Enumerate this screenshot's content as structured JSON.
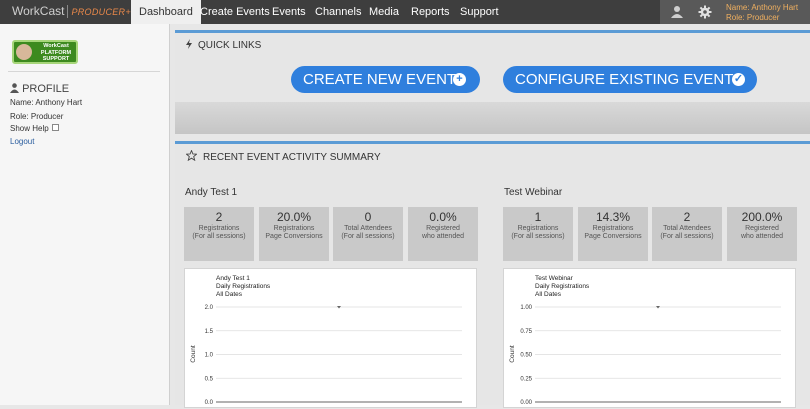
{
  "app": {
    "brand": "WorkCast",
    "product": "PRODUCER+"
  },
  "nav": [
    "Dashboard",
    "Create Events",
    "Events",
    "Channels",
    "Media",
    "Reports",
    "Support"
  ],
  "user": {
    "name_line": "Name: Anthony Hart",
    "role_line": "Role: Producer"
  },
  "sidebar": {
    "badge_lines": [
      "WorkCast",
      "PLATFORM",
      "SUPPORT"
    ],
    "profile_heading": "PROFILE",
    "name": "Name: Anthony Hart",
    "role": "Role: Producer",
    "show_help": "Show Help",
    "logout": "Logout"
  },
  "quick_links": {
    "heading": "QUICK LINKS",
    "create_label": "CREATE NEW EVENT",
    "configure_label": "CONFIGURE EXISTING EVENT"
  },
  "recent": {
    "heading": "RECENT EVENT ACTIVITY SUMMARY",
    "events": [
      {
        "title": "Andy Test 1",
        "stats": [
          {
            "value": "2",
            "label": "Registrations\n(For all sessions)"
          },
          {
            "value": "20.0%",
            "label": "Registrations\nPage Conversions"
          },
          {
            "value": "0",
            "label": "Total Attendees\n(For all sessions)"
          },
          {
            "value": "0.0%",
            "label": "Registered\nwho attended"
          }
        ],
        "chart_data": {
          "type": "line",
          "title": "Andy Test 1\nDaily Registrations\nAll Dates",
          "ylabel": "Count",
          "yticks": [
            "2.0",
            "1.5",
            "1.0",
            "0.5",
            "0.0"
          ],
          "ylim": [
            0,
            2
          ],
          "grid": true,
          "points": [
            {
              "y": 2
            }
          ]
        }
      },
      {
        "title": "Test Webinar",
        "stats": [
          {
            "value": "1",
            "label": "Registrations\n(For all sessions)"
          },
          {
            "value": "14.3%",
            "label": "Registrations\nPage Conversions"
          },
          {
            "value": "2",
            "label": "Total Attendees\n(For all sessions)"
          },
          {
            "value": "200.0%",
            "label": "Registered\nwho attended"
          }
        ],
        "chart_data": {
          "type": "line",
          "title": "Test Webinar\nDaily Registrations\nAll Dates",
          "ylabel": "Count",
          "yticks": [
            "1.00",
            "0.75",
            "0.50",
            "0.25",
            "0.00"
          ],
          "ylim": [
            0,
            1
          ],
          "grid": true,
          "points": [
            {
              "y": 1
            }
          ]
        }
      }
    ]
  },
  "colors": {
    "accent": "#5b9bd5",
    "button": "#2f7fdd",
    "topbar": "#3e3e3e",
    "username": "#f0b060"
  }
}
